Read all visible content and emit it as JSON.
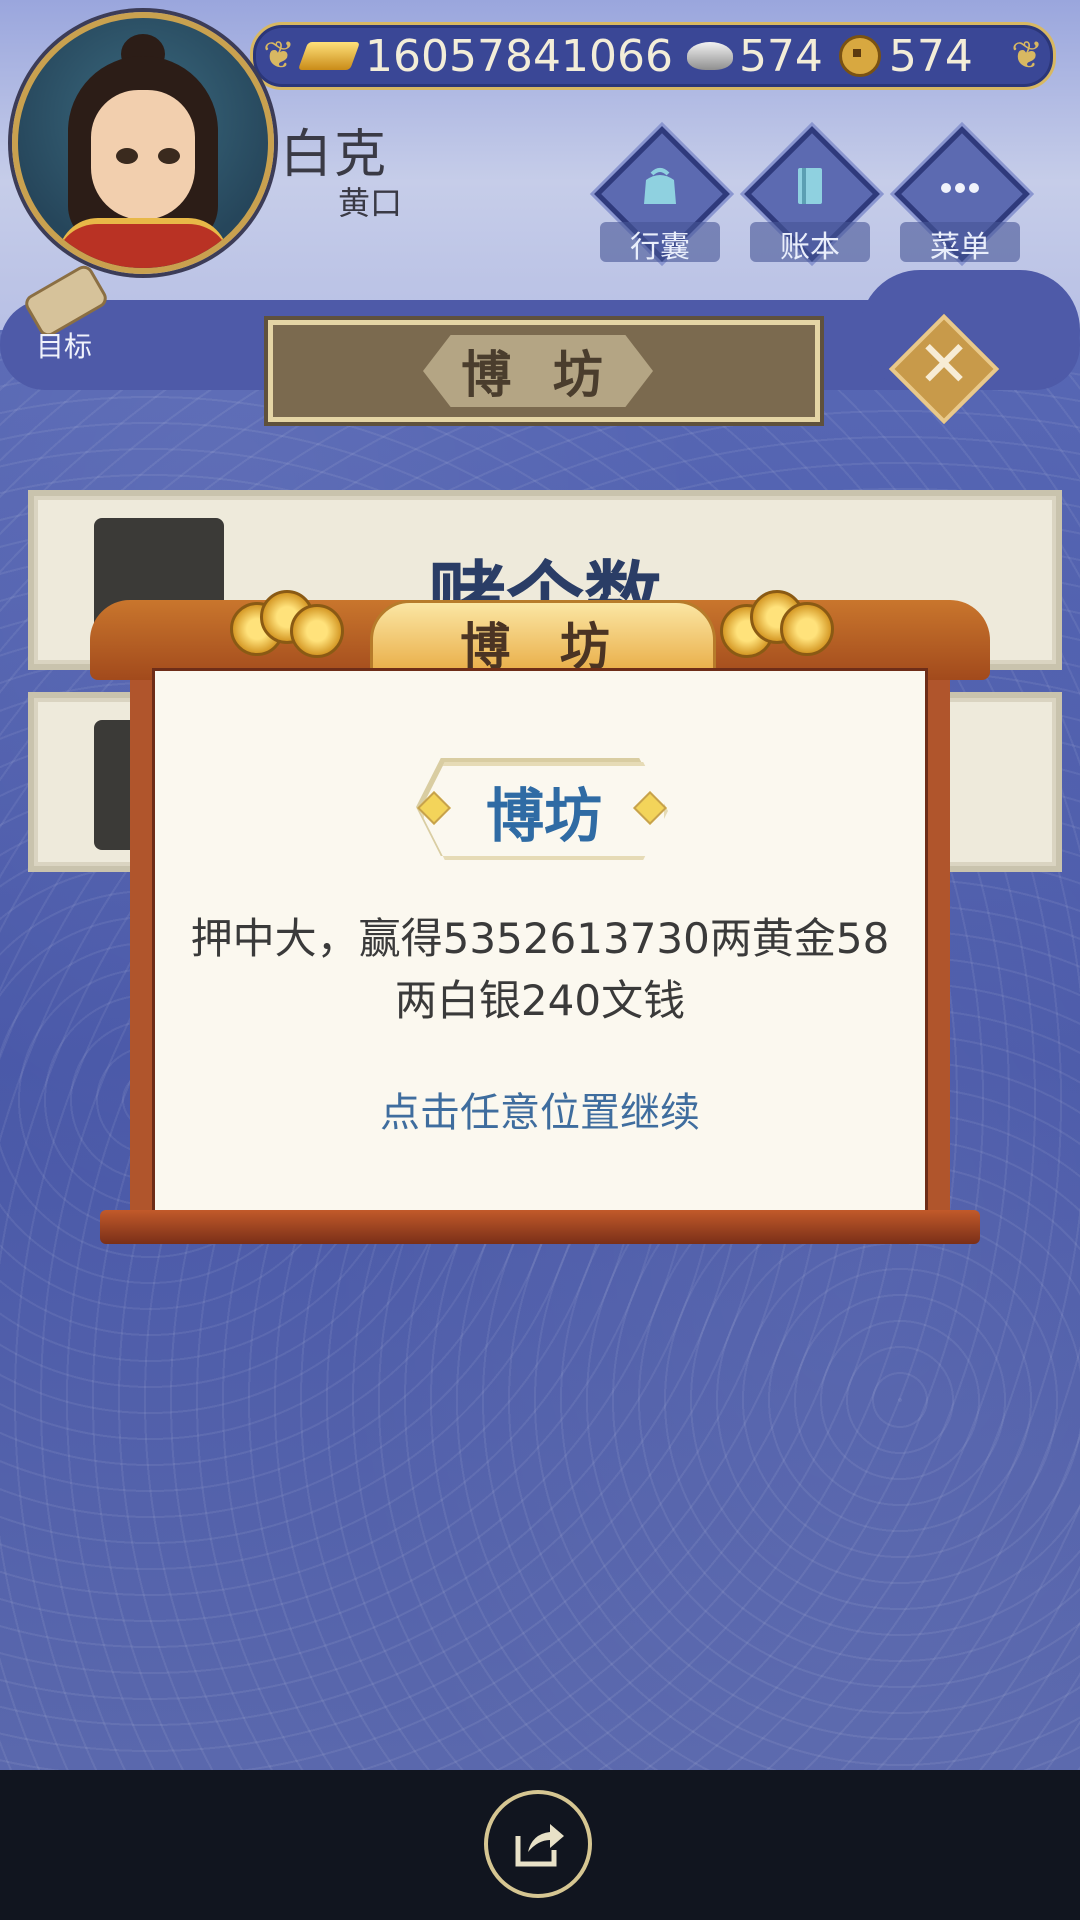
{
  "currency": {
    "gold": "16057841066",
    "silver": "574",
    "copper": "574"
  },
  "player": {
    "name": "白克",
    "subtitle": "黄口"
  },
  "menu": {
    "bag_label": "行囊",
    "ledger_label": "账本",
    "menu_label": "菜单",
    "goal_label": "目标"
  },
  "page": {
    "title": "博 坊"
  },
  "games": [
    {
      "title": "赌个数"
    },
    {
      "title": ""
    }
  ],
  "modal": {
    "banner": "博 坊",
    "heading": "博坊",
    "message": "押中大，赢得5352613730两黄金58两白银240文钱",
    "hint": "点击任意位置继续"
  },
  "colors": {
    "accent_gold": "#d8b862",
    "modal_frame": "#b0552c",
    "heading_blue": "#2f6ba4"
  },
  "icons": {
    "share": "share-icon",
    "close": "close-icon"
  }
}
